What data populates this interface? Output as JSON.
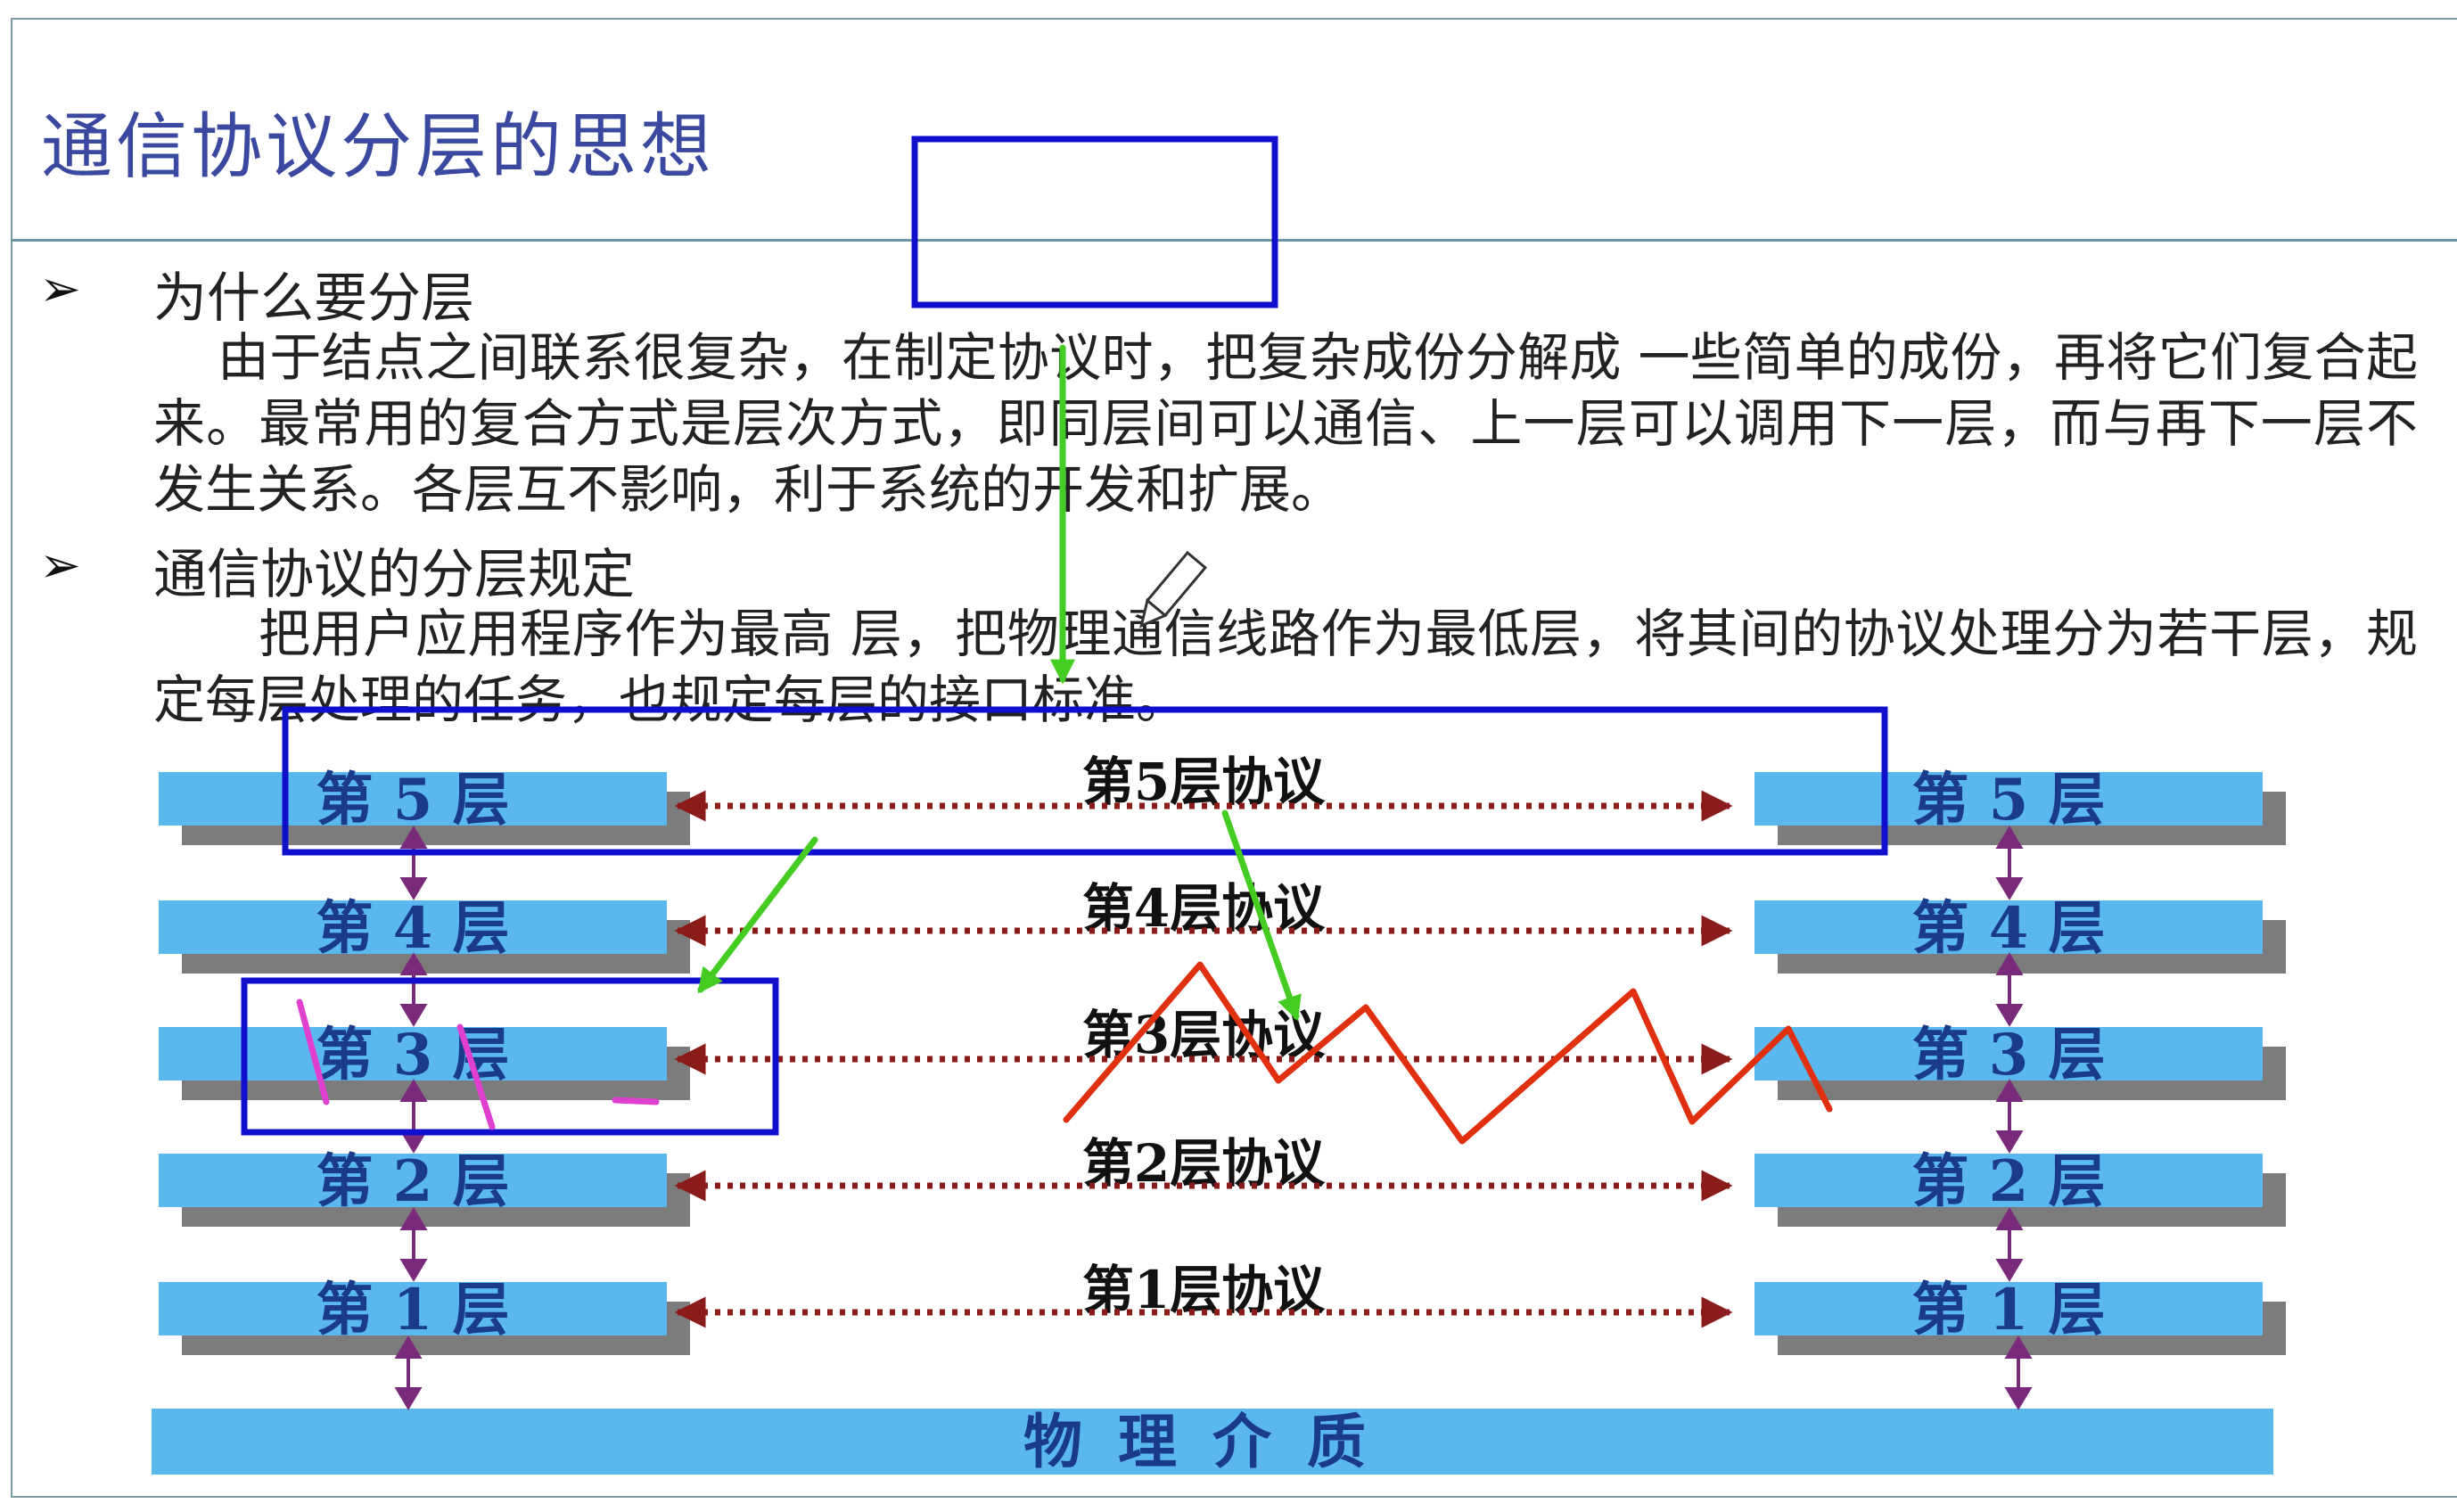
{
  "slide": {
    "title": "通信协议分层的思想",
    "sections": [
      {
        "bullet": "➢",
        "heading": "为什么要分层",
        "text": "由于结点之间联系很复杂，在制定协议时，把复杂成份分解成 一些简单的成份，再将它们复合起来。最常用的复合方式是层次方式，即同层间可以通信、上一层可以调用下一层，而与再下一层不发生关系。各层互不影响，利于系统的开发和扩展。"
      },
      {
        "bullet": "➢",
        "heading": "通信协议的分层规定",
        "text": "把用户应用程序作为最高 层，把物理通信线路作为最低层，将其间的协议处理分为若干层，规定每层处理的任务，也规定每层的接口标准。"
      }
    ]
  },
  "diagram": {
    "left_layers": [
      "第 5 层",
      "第 4 层",
      "第 3 层",
      "第 2 层",
      "第 1 层"
    ],
    "right_layers": [
      "第 5 层",
      "第 4 层",
      "第 3 层",
      "第 2 层",
      "第 1 层"
    ],
    "protocols": [
      "第5层协议",
      "第4层协议",
      "第3层协议",
      "第2层协议",
      "第1层协议"
    ],
    "medium": "物理介质",
    "colors": {
      "layer_fill": "#5ab8ef",
      "layer_text": "#1a3a8a",
      "protocol_arrow": "#8b1a1a",
      "interface_arrow": "#7a2a7a",
      "annotation_box": "#1010cc",
      "annotation_arrow": "#44cc22",
      "annotation_scribble": "#e03010",
      "annotation_marks": "#e040d0"
    }
  }
}
